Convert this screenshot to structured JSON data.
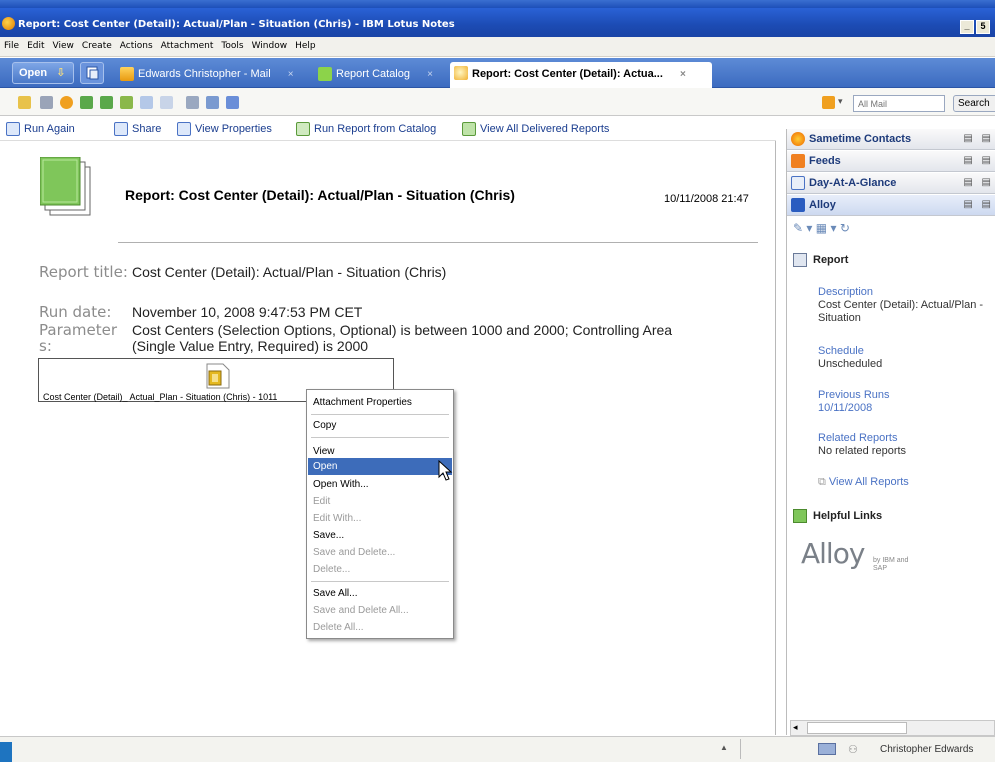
{
  "window": {
    "title": "Report: Cost Center (Detail): Actual/Plan - Situation (Chris) - IBM Lotus Notes",
    "min_label": "_",
    "max_label": "5"
  },
  "menu": [
    "File",
    "Edit",
    "View",
    "Create",
    "Actions",
    "Attachment",
    "Tools",
    "Window",
    "Help"
  ],
  "tabs": {
    "open_label": "Open",
    "mail_label": "Edwards Christopher - Mail",
    "catalog_label": "Report Catalog",
    "active_label": "Report: Cost Center (Detail): Actua...",
    "close_glyph": "×"
  },
  "toolbar": {
    "search_placeholder": "All Mail",
    "search_button": "Search"
  },
  "actions": {
    "run_again": "Run Again",
    "share": "Share",
    "view_properties": "View Properties",
    "run_from_catalog": "Run Report from Catalog",
    "view_all_delivered": "View All Delivered Reports"
  },
  "document": {
    "title": "Report: Cost Center (Detail): Actual/Plan - Situation (Chris)",
    "date": "10/11/2008 21:47",
    "fields": {
      "report_title_label": "Report title:",
      "report_title_value": "Cost Center (Detail): Actual/Plan - Situation (Chris)",
      "run_date_label": "Run date:",
      "run_date_value": "November 10, 2008 9:47:53 PM CET",
      "parameters_label": "Parameters:",
      "parameters_value": "Cost Centers (Selection Options, Optional) is between 1000 and 2000; Controlling Area (Single Value Entry, Required) is 2000"
    },
    "attachment_name": "Cost Center (Detail)_ Actual_Plan - Situation (Chris) - 1011"
  },
  "context_menu": {
    "items": [
      {
        "label": "Attachment Properties",
        "state": "normal"
      },
      {
        "label": "Copy",
        "state": "normal"
      },
      {
        "label": "View",
        "state": "normal"
      },
      {
        "label": "Open",
        "state": "selected"
      },
      {
        "label": "Open With...",
        "state": "normal"
      },
      {
        "label": "Edit",
        "state": "disabled"
      },
      {
        "label": "Edit With...",
        "state": "disabled"
      },
      {
        "label": "Save...",
        "state": "normal"
      },
      {
        "label": "Save and Delete...",
        "state": "disabled"
      },
      {
        "label": "Delete...",
        "state": "disabled"
      },
      {
        "label": "Save All...",
        "state": "normal"
      },
      {
        "label": "Save and Delete All...",
        "state": "disabled"
      },
      {
        "label": "Delete All...",
        "state": "disabled"
      }
    ]
  },
  "sidebar": {
    "panels": [
      "Sametime Contacts",
      "Feeds",
      "Day-At-A-Glance",
      "Alloy"
    ],
    "report_heading": "Report",
    "description_label": "Description",
    "description_value": "Cost Center (Detail): Actual/Plan - Situation",
    "schedule_label": "Schedule",
    "schedule_value": "Unscheduled",
    "previous_runs_label": "Previous Runs",
    "previous_runs_value": "10/11/2008",
    "related_reports_label": "Related Reports",
    "related_reports_value": "No related reports",
    "view_all_reports": "View All Reports",
    "helpful_links": "Helpful Links",
    "alloy_logo": "Alloy",
    "alloy_tagline": "by IBM and SAP"
  },
  "status": {
    "user": "Christopher Edwards"
  },
  "colors": {
    "title_bar": "#1c4bb3",
    "tab_bar": "#3c6bc0",
    "menu_highlight": "#3d6cba",
    "link": "#1a3d8f"
  }
}
